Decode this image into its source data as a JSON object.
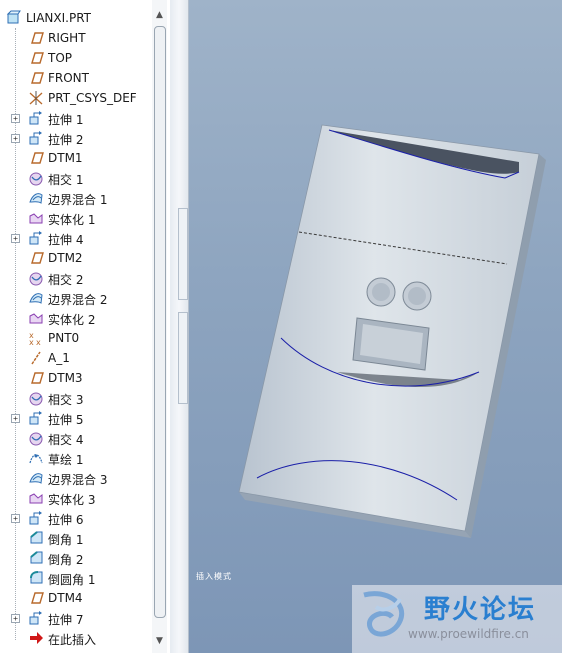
{
  "model_tree": {
    "root": "LIANXI.PRT",
    "items": [
      {
        "label": "RIGHT",
        "icon": "datum-plane-icon",
        "expandable": false
      },
      {
        "label": "TOP",
        "icon": "datum-plane-icon",
        "expandable": false
      },
      {
        "label": "FRONT",
        "icon": "datum-plane-icon",
        "expandable": false
      },
      {
        "label": "PRT_CSYS_DEF",
        "icon": "coordinate-system-icon",
        "expandable": false
      },
      {
        "label": "拉伸 1",
        "icon": "extrude-icon",
        "expandable": true
      },
      {
        "label": "拉伸 2",
        "icon": "extrude-icon",
        "expandable": true
      },
      {
        "label": "DTM1",
        "icon": "datum-plane-icon",
        "expandable": false
      },
      {
        "label": "相交 1",
        "icon": "intersect-icon",
        "expandable": false
      },
      {
        "label": "边界混合 1",
        "icon": "boundary-blend-icon",
        "expandable": false
      },
      {
        "label": "实体化 1",
        "icon": "solidify-icon",
        "expandable": false
      },
      {
        "label": "拉伸 4",
        "icon": "extrude-icon",
        "expandable": true
      },
      {
        "label": "DTM2",
        "icon": "datum-plane-icon",
        "expandable": false
      },
      {
        "label": "相交 2",
        "icon": "intersect-icon",
        "expandable": false
      },
      {
        "label": "边界混合 2",
        "icon": "boundary-blend-icon",
        "expandable": false
      },
      {
        "label": "实体化 2",
        "icon": "solidify-icon",
        "expandable": false
      },
      {
        "label": "PNT0",
        "icon": "datum-point-icon",
        "expandable": false
      },
      {
        "label": "A_1",
        "icon": "datum-axis-icon",
        "expandable": false
      },
      {
        "label": "DTM3",
        "icon": "datum-plane-icon",
        "expandable": false
      },
      {
        "label": "相交 3",
        "icon": "intersect-icon",
        "expandable": false
      },
      {
        "label": "拉伸 5",
        "icon": "extrude-icon",
        "expandable": true
      },
      {
        "label": "相交 4",
        "icon": "intersect-icon",
        "expandable": false
      },
      {
        "label": "草绘 1",
        "icon": "sketch-icon",
        "expandable": false
      },
      {
        "label": "边界混合 3",
        "icon": "boundary-blend-icon",
        "expandable": false
      },
      {
        "label": "实体化 3",
        "icon": "solidify-icon",
        "expandable": false
      },
      {
        "label": "拉伸 6",
        "icon": "extrude-icon",
        "expandable": true
      },
      {
        "label": "倒角 1",
        "icon": "chamfer-icon",
        "expandable": false
      },
      {
        "label": "倒角 2",
        "icon": "chamfer-icon",
        "expandable": false
      },
      {
        "label": "倒圆角 1",
        "icon": "round-icon",
        "expandable": false
      },
      {
        "label": "DTM4",
        "icon": "datum-plane-icon",
        "expandable": false
      },
      {
        "label": "拉伸 7",
        "icon": "extrude-icon",
        "expandable": true
      },
      {
        "label": "在此插入",
        "icon": "insert-here-arrow-icon",
        "expandable": false
      }
    ]
  },
  "viewport": {
    "mode_label": "插入模式"
  },
  "watermark": {
    "title": "野火论坛",
    "url": "www.proewildfire.cn"
  },
  "colors": {
    "viewport_top": "#9fb3c9",
    "viewport_bottom": "#7d96b6",
    "datum_plane": "#b86a2c",
    "feature_icon": "#2f6fb4",
    "selection_curve": "#1a1fa8",
    "insert_arrow": "#d01818",
    "watermark_blue": "#2a7fd0"
  }
}
